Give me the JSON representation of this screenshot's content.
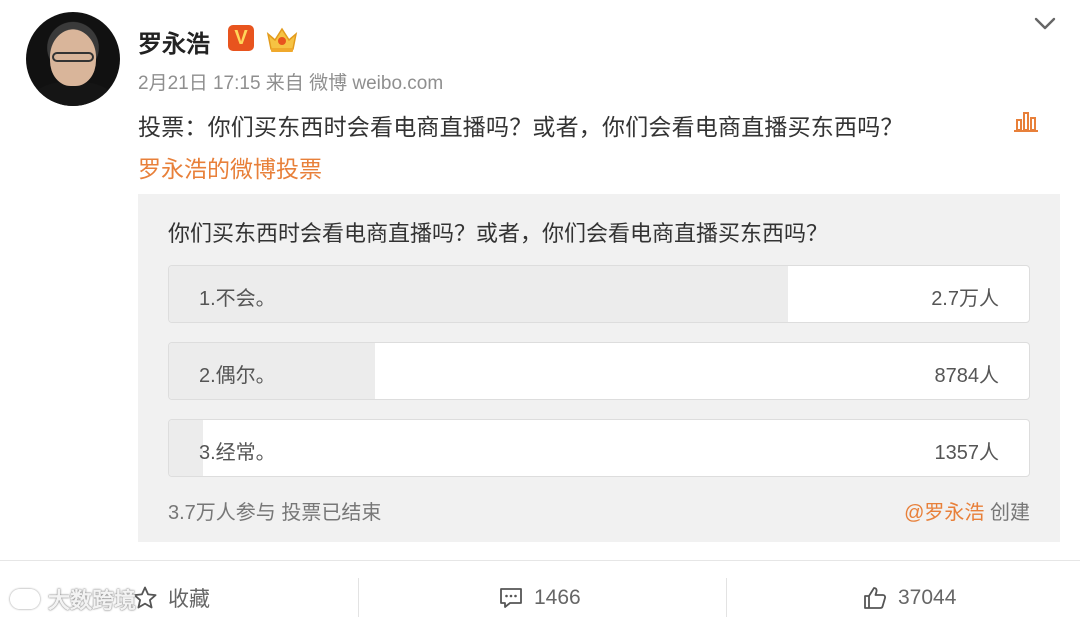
{
  "author": {
    "name": "罗永浩",
    "badge_v": "V"
  },
  "post": {
    "meta": "2月21日 17:15 来自 微博 weibo.com",
    "text": "投票：你们买东西时会看电商直播吗？或者，你们会看电商直播买东西吗？",
    "vote_link": "罗永浩的微博投票"
  },
  "poll": {
    "question": "你们买东西时会看电商直播吗？或者，你们会看电商直播买东西吗？",
    "options": [
      {
        "label": "1.不会。",
        "count": "2.7万人",
        "share": 0.72
      },
      {
        "label": "2.偶尔。",
        "count": "8784人",
        "share": 0.24
      },
      {
        "label": "3.经常。",
        "count": "1357人",
        "share": 0.04
      }
    ],
    "footer_left": "3.7万人参与 投票已结束",
    "creator_at": "@罗永浩",
    "creator_suffix": " 创建"
  },
  "actions": {
    "favorite": "收藏",
    "comments": "1466",
    "likes": "37044"
  },
  "watermark": "大数跨境",
  "colors": {
    "accent_orange": "#e8803a",
    "badge_orange": "#e8541e",
    "poll_bg": "#f1f1f1"
  },
  "icons": [
    "v-badge-icon",
    "crown-icon",
    "chevron-down-icon",
    "bar-chart-icon",
    "star-icon",
    "comment-icon",
    "thumbs-up-icon"
  ]
}
